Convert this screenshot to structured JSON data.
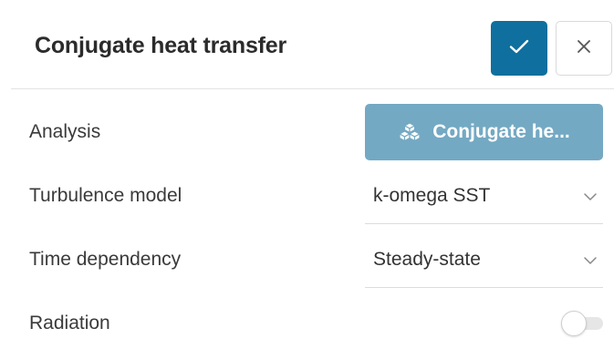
{
  "header": {
    "title": "Conjugate heat transfer",
    "confirm_icon": "check-icon",
    "cancel_icon": "close-icon"
  },
  "rows": {
    "analysis": {
      "label": "Analysis",
      "button_label": "Conjugate he...",
      "button_icon": "cubes-icon"
    },
    "turbulence": {
      "label": "Turbulence model",
      "value": "k-omega SST",
      "icon": "chevron-down-icon"
    },
    "time": {
      "label": "Time dependency",
      "value": "Steady-state",
      "icon": "chevron-down-icon"
    },
    "radiation": {
      "label": "Radiation",
      "enabled": false
    }
  },
  "colors": {
    "primary": "#0f6f9e",
    "analysis_button": "#74a9c3",
    "divider": "#e3e3e3"
  }
}
